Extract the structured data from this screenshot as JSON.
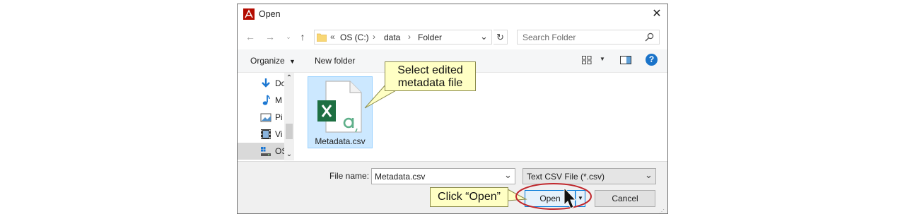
{
  "window": {
    "title": "Open",
    "app_icon": "adobe-acrobat-icon"
  },
  "nav": {
    "path_prefix": "«",
    "path": [
      "OS (C:)",
      "data",
      "Folder"
    ]
  },
  "search": {
    "placeholder": "Search Folder"
  },
  "toolbar": {
    "organize_label": "Organize",
    "new_folder_label": "New folder"
  },
  "sidebar": {
    "items": [
      {
        "label": "Do",
        "icon": "downloads-icon"
      },
      {
        "label": "M",
        "icon": "music-icon"
      },
      {
        "label": "Pi",
        "icon": "pictures-icon"
      },
      {
        "label": "Vi",
        "icon": "videos-icon"
      },
      {
        "label": "OS",
        "icon": "drive-icon",
        "selected": true
      }
    ]
  },
  "files": [
    {
      "name": "Metadata.csv",
      "icon": "excel-csv-icon",
      "selected": true
    }
  ],
  "footer": {
    "filename_label": "File name:",
    "filename_value": "Metadata.csv",
    "filetype_value": "Text CSV File (*.csv)",
    "open_label": "Open",
    "cancel_label": "Cancel"
  },
  "annotations": {
    "select_callout": "Select edited metadata file",
    "open_callout": "Click “Open”"
  },
  "colors": {
    "accent": "#0078d7",
    "selection": "#cce8ff",
    "callout_bg": "#ffffc4",
    "highlight_ring": "#c0282d",
    "excel_green": "#1d6f42"
  }
}
